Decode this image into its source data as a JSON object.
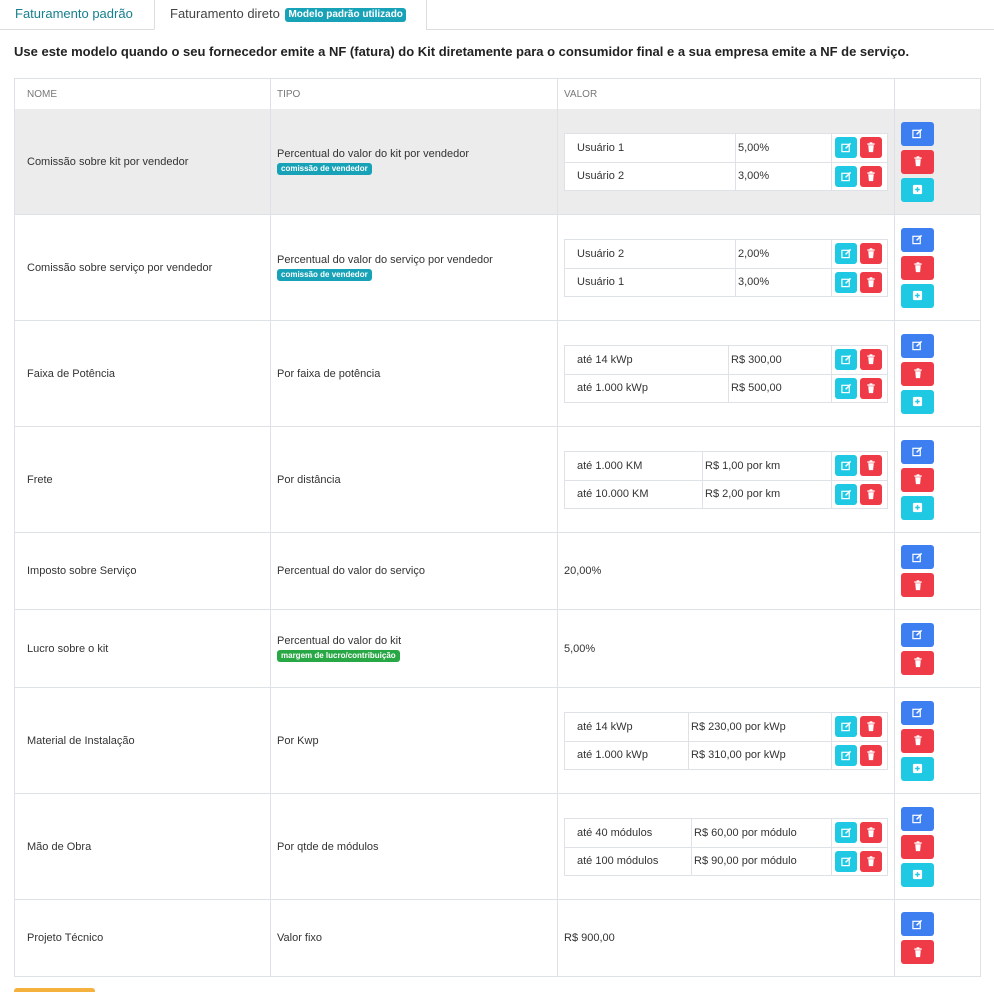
{
  "tabs": [
    {
      "label": "Faturamento padrão"
    },
    {
      "label": "Faturamento direto",
      "badge": "Modelo padrão utilizado"
    }
  ],
  "intro": "Use este modelo quando o seu fornecedor emite a NF (fatura) do Kit diretamente para o consumidor final e a sua empresa emite a NF de serviço.",
  "table": {
    "headers": {
      "nome": "NOME",
      "tipo": "TIPO",
      "valor": "VALOR"
    },
    "rows": [
      {
        "nome": "Comissão sobre kit por vendedor",
        "tipo": "Percentual do valor do kit por vendedor",
        "tag": "comissão de vendedor",
        "values": [
          {
            "k": "Usuário 1",
            "v": "5,00%"
          },
          {
            "k": "Usuário 2",
            "v": "3,00%"
          }
        ]
      },
      {
        "nome": "Comissão sobre serviço por vendedor",
        "tipo": "Percentual do valor do serviço por vendedor",
        "tag": "comissão de vendedor",
        "values": [
          {
            "k": "Usuário 2",
            "v": "2,00%"
          },
          {
            "k": "Usuário 1",
            "v": "3,00%"
          }
        ]
      },
      {
        "nome": "Faixa de Potência",
        "tipo": "Por faixa de potência",
        "values": [
          {
            "k": "até 14 kWp",
            "v": "R$ 300,00"
          },
          {
            "k": "até 1.000 kWp",
            "v": "R$ 500,00"
          }
        ]
      },
      {
        "nome": "Frete",
        "tipo": "Por distância",
        "values": [
          {
            "k": "até 1.000 KM",
            "v": "R$ 1,00 por km"
          },
          {
            "k": "até 10.000 KM",
            "v": "R$ 2,00 por km"
          }
        ]
      },
      {
        "nome": "Imposto sobre Serviço",
        "tipo": "Percentual do valor do serviço",
        "value": "20,00%"
      },
      {
        "nome": "Lucro sobre o kit",
        "tipo": "Percentual do valor do kit",
        "tag": "margem de lucro/contribuição",
        "value": "5,00%"
      },
      {
        "nome": "Material de Instalação",
        "tipo": "Por Kwp",
        "values": [
          {
            "k": "até 14 kWp",
            "v": "R$ 230,00 por kWp"
          },
          {
            "k": "até 1.000 kWp",
            "v": "R$ 310,00 por kWp"
          }
        ]
      },
      {
        "nome": "Mão de Obra",
        "tipo": "Por qtde de módulos",
        "values": [
          {
            "k": "até 40 módulos",
            "v": "R$ 60,00 por módulo"
          },
          {
            "k": "até 100 módulos",
            "v": "R$ 90,00 por módulo"
          }
        ]
      },
      {
        "nome": "Projeto Técnico",
        "tipo": "Valor fixo",
        "value": "R$ 900,00"
      }
    ]
  },
  "colors": {
    "accent": "#17808e",
    "edit": "#3d7ff0",
    "edit_small": "#1fc8e3",
    "delete": "#ef3a48",
    "tag_teal": "#17a2b8",
    "tag_green": "#28a745",
    "highlight_row": "#ececec"
  },
  "icons": {
    "edit": "edit-icon",
    "delete": "trash-icon",
    "add": "plus-square-icon"
  }
}
